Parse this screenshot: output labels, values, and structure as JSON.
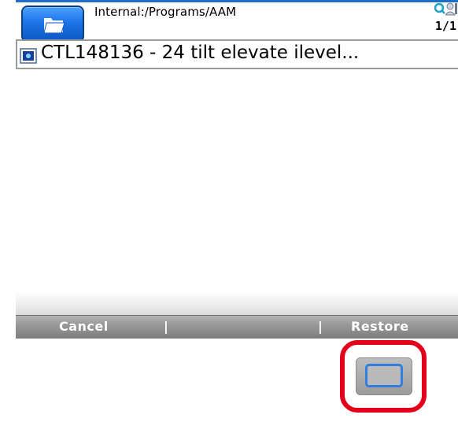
{
  "header": {
    "path": "Internal:/Programs/AAM",
    "page_counter": "1/1",
    "folder_icon": "folder-open-icon",
    "status_icons": [
      "search-icon",
      "user-icon"
    ]
  },
  "file_list": {
    "items": [
      {
        "label": "CTL148136 - 24 tilt elevate ilevel...",
        "icon": "program-file-icon"
      }
    ]
  },
  "softkeys": {
    "left_label": "Cancel",
    "right_label": "Restore",
    "separator": "|"
  },
  "hardware": {
    "center_key_icon": "center-select-key"
  },
  "colors": {
    "accent_blue": "#1d74e6",
    "highlight_red": "#e3001b",
    "softkey_gray": "#9b9b9b"
  }
}
